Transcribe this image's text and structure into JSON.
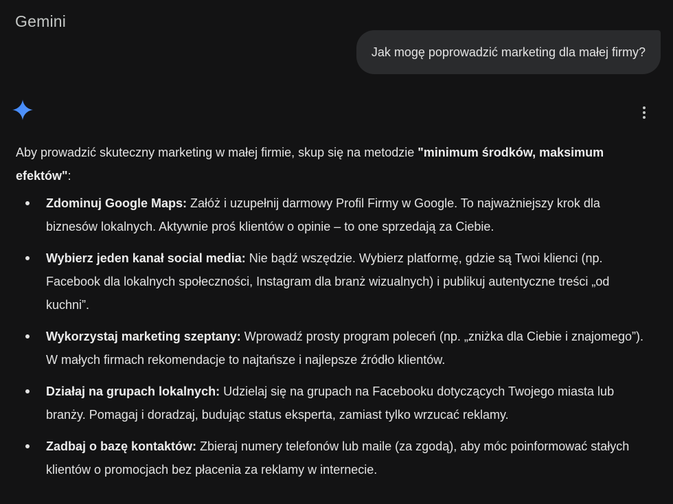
{
  "app": {
    "title": "Gemini"
  },
  "user_message": {
    "text": "Jak mogę poprowadzić marketing dla małej firmy?"
  },
  "response": {
    "icon": "gemini-spark-icon",
    "menu_icon": "more-vert-icon",
    "intro_text": "Aby prowadzić skuteczny marketing w małej firmie, skup się na metodzie ",
    "intro_bold": "\"minimum środków, maksimum efektów\"",
    "intro_end": ":",
    "points": [
      {
        "title": "Zdominuj Google Maps:",
        "text": " Załóż i uzupełnij darmowy Profil Firmy w Google. To najważniejszy krok dla biznesów lokalnych. Aktywnie proś klientów o opinie – to one sprzedają za Ciebie."
      },
      {
        "title": "Wybierz jeden kanał social media:",
        "text": " Nie bądź wszędzie. Wybierz platformę, gdzie są Twoi klienci (np. Facebook dla lokalnych społeczności, Instagram dla branż wizualnych) i publikuj autentyczne treści „od kuchni”."
      },
      {
        "title": "Wykorzystaj marketing szeptany:",
        "text": " Wprowadź prosty program poleceń (np. „zniżka dla Ciebie i znajomego”). W małych firmach rekomendacje to najtańsze i najlepsze źródło klientów."
      },
      {
        "title": "Działaj na grupach lokalnych:",
        "text": " Udzielaj się na grupach na Facebooku dotyczących Twojego miasta lub branży. Pomagaj i doradzaj, budując status eksperta, zamiast tylko wrzucać reklamy."
      },
      {
        "title": "Zadbaj o bazę kontaktów:",
        "text": " Zbieraj numery telefonów lub maile (za zgodą), aby móc poinformować stałych klientów o promocjach bez płacenia za reklamy w internecie."
      }
    ]
  },
  "colors": {
    "background": "#131314",
    "bubble": "#2a2b2d",
    "text": "#e3e3e3",
    "spark_blue": "#4f8df7"
  }
}
